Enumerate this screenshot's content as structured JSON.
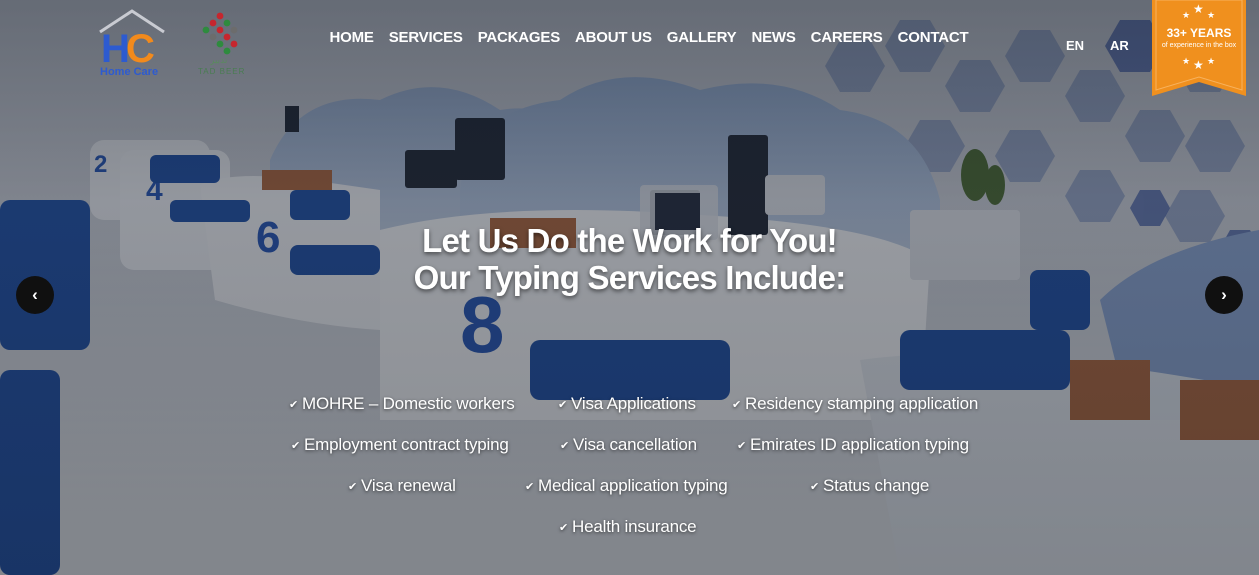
{
  "header": {
    "logo_homecare": {
      "text": "Home Care",
      "letters": "HC"
    },
    "logo_tadbeer": {
      "text": "TAD BEER",
      "arabic": "تدبير"
    },
    "nav": [
      {
        "label": "HOME"
      },
      {
        "label": "SERVICES"
      },
      {
        "label": "PACKAGES"
      },
      {
        "label": "ABOUT US"
      },
      {
        "label": "GALLERY"
      },
      {
        "label": "NEWS"
      },
      {
        "label": "CAREERS"
      },
      {
        "label": "CONTACT"
      }
    ],
    "lang": {
      "en": "EN",
      "ar": "AR"
    },
    "badge": {
      "title": "33+ YEARS",
      "subtitle": "of experience in the box",
      "star": "★"
    }
  },
  "hero": {
    "title_line1": "Let Us Do the Work for You!",
    "title_line2": "Our Typing Services Include:",
    "check_icon": "✔",
    "services": [
      "MOHRE – Domestic workers",
      "Visa Applications",
      "Residency stamping application",
      "Employment contract typing",
      "Visa cancellation",
      "Emirates ID application typing",
      "Visa renewal",
      "Medical application typing",
      "Status change",
      "Health insurance"
    ],
    "carousel": {
      "prev_icon": "‹",
      "next_icon": "›"
    }
  },
  "colors": {
    "brand_blue": "#2d5bd0",
    "brand_orange": "#f28a1c",
    "badge_orange": "#f0901e",
    "seat_blue": "#1d4fa8"
  }
}
